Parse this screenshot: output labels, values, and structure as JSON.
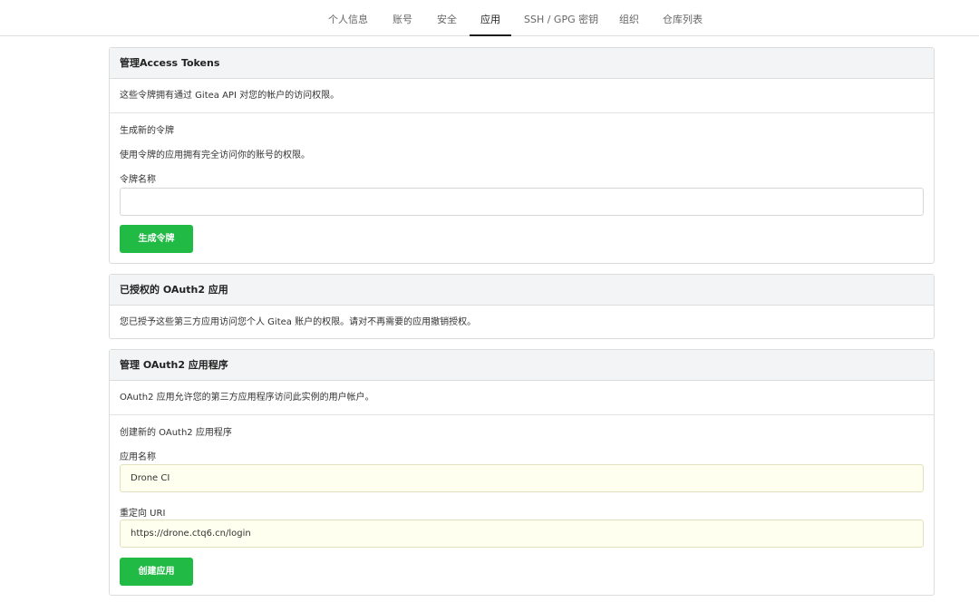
{
  "nav": {
    "tabs": [
      {
        "label": "个人信息"
      },
      {
        "label": "账号"
      },
      {
        "label": "安全"
      },
      {
        "label": "应用"
      },
      {
        "label": "SSH / GPG 密钥"
      },
      {
        "label": "组织"
      },
      {
        "label": "仓库列表"
      }
    ],
    "active_tab": "应用"
  },
  "access_tokens": {
    "title": "管理Access Tokens",
    "description": "这些令牌拥有通过 Gitea API 对您的帐户的访问权限。",
    "generate_heading": "生成新的令牌",
    "generate_desc": "使用令牌的应用拥有完全访问你的账号的权限。",
    "name_label": "令牌名称",
    "name_value": "",
    "button_label": "生成令牌"
  },
  "authorized_oauth2": {
    "title": "已授权的 OAuth2 应用",
    "description": "您已授予这些第三方应用访问您个人 Gitea 账户的权限。请对不再需要的应用撤销授权。"
  },
  "manage_oauth2": {
    "title": "管理 OAuth2 应用程序",
    "description": "OAuth2 应用允许您的第三方应用程序访问此实例的用户帐户。",
    "create_heading": "创建新的 OAuth2 应用程序",
    "app_name_label": "应用名称",
    "app_name_value": "Drone CI",
    "redirect_label": "重定向 URI",
    "redirect_value": "https://drone.ctq6.cn/login",
    "button_label": "创建应用"
  },
  "colors": {
    "primary_button": "#21ba45",
    "filled_input_bg": "#fffff0",
    "panel_header_bg": "#f3f4f5"
  }
}
